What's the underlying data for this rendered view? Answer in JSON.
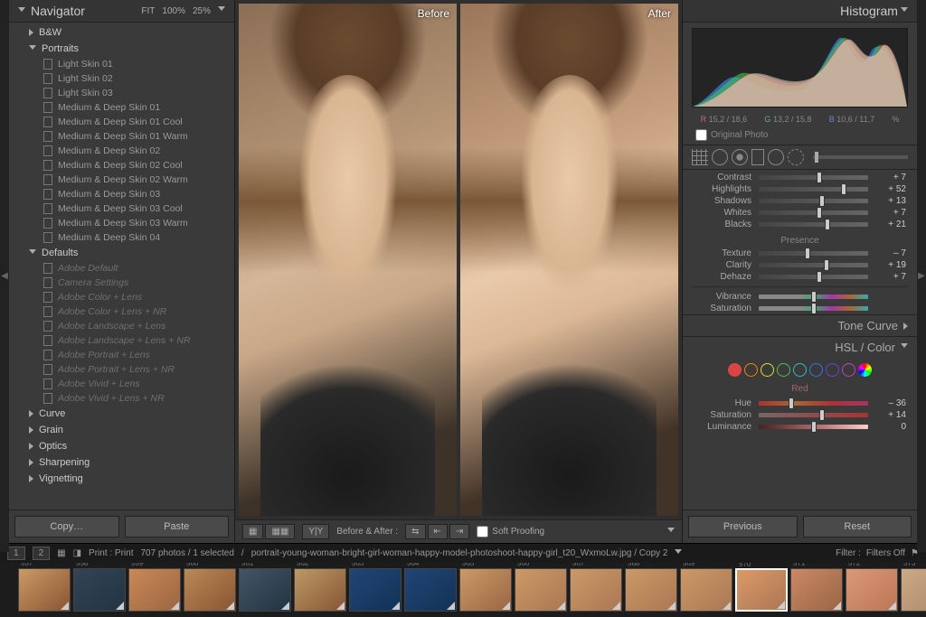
{
  "navigator": {
    "title": "Navigator",
    "zoom": [
      "FIT",
      "100%",
      "25%"
    ]
  },
  "presets": {
    "groups": [
      {
        "name": "B&W",
        "open": false,
        "items": []
      },
      {
        "name": "Portraits",
        "open": true,
        "items": [
          "Light Skin 01",
          "Light Skin 02",
          "Light Skin 03",
          "Medium & Deep Skin 01",
          "Medium & Deep Skin 01 Cool",
          "Medium & Deep Skin 01 Warm",
          "Medium & Deep Skin 02",
          "Medium & Deep Skin 02 Cool",
          "Medium & Deep Skin 02 Warm",
          "Medium & Deep Skin 03",
          "Medium & Deep Skin 03 Cool",
          "Medium & Deep Skin 03 Warm",
          "Medium & Deep Skin 04"
        ]
      },
      {
        "name": "Defaults",
        "open": true,
        "items": [
          "Adobe Default",
          "Camera Settings",
          "Adobe Color + Lens",
          "Adobe Color + Lens + NR",
          "Adobe Landscape + Lens",
          "Adobe Landscape + Lens + NR",
          "Adobe Portrait + Lens",
          "Adobe Portrait + Lens + NR",
          "Adobe Vivid + Lens",
          "Adobe Vivid + Lens + NR"
        ],
        "dim": true
      },
      {
        "name": "Curve",
        "open": false,
        "items": []
      },
      {
        "name": "Grain",
        "open": false,
        "items": []
      },
      {
        "name": "Optics",
        "open": false,
        "items": []
      },
      {
        "name": "Sharpening",
        "open": false,
        "items": []
      },
      {
        "name": "Vignetting",
        "open": false,
        "items": []
      }
    ]
  },
  "leftButtons": {
    "copy": "Copy…",
    "paste": "Paste"
  },
  "compare": {
    "before": "Before",
    "after": "After",
    "toolbar_label": "Before & After :",
    "soft_proof": "Soft Proofing"
  },
  "rightButtons": {
    "prev": "Previous",
    "reset": "Reset"
  },
  "histogram": {
    "title": "Histogram",
    "readout": {
      "rLabel": "R",
      "r": "15,2 / 18,6",
      "gLabel": "G",
      "g": "13,2 / 15,8",
      "bLabel": "B",
      "b": "10,6 / 11,7",
      "pct": "%"
    },
    "original": "Original Photo"
  },
  "basic": {
    "rows": [
      {
        "label": "Contrast",
        "val": "+ 7",
        "pos": 55
      },
      {
        "label": "Highlights",
        "val": "+ 52",
        "pos": 78
      },
      {
        "label": "Shadows",
        "val": "+ 13",
        "pos": 58
      },
      {
        "label": "Whites",
        "val": "+ 7",
        "pos": 55
      },
      {
        "label": "Blacks",
        "val": "+ 21",
        "pos": 63
      }
    ],
    "presence": "Presence",
    "presRows": [
      {
        "label": "Texture",
        "val": "– 7",
        "pos": 45
      },
      {
        "label": "Clarity",
        "val": "+ 19",
        "pos": 62
      },
      {
        "label": "Dehaze",
        "val": "+ 7",
        "pos": 55
      }
    ],
    "colorRows": [
      {
        "label": "Vibrance",
        "val": "",
        "pos": 50,
        "cls": "vib-t"
      },
      {
        "label": "Saturation",
        "val": "",
        "pos": 50,
        "cls": "vib-t"
      }
    ]
  },
  "panels": {
    "tone": "Tone Curve",
    "hsl": "HSL / Color"
  },
  "hsl": {
    "colors": [
      "#d44",
      "#e80",
      "#dd3",
      "#5b5",
      "#3bb",
      "#37d",
      "#64d",
      "#b4b"
    ],
    "channel": "Red",
    "rows": [
      {
        "label": "Hue",
        "val": "– 36",
        "pos": 30,
        "cls": "hue-t"
      },
      {
        "label": "Saturation",
        "val": "+ 14",
        "pos": 58,
        "cls": "sat-t"
      },
      {
        "label": "Luminance",
        "val": "0",
        "pos": 50,
        "cls": "lum-t"
      }
    ]
  },
  "status": {
    "pages": [
      "1",
      "2"
    ],
    "print": "Print : Print",
    "count": "707 photos / 1 selected",
    "crumb": "portrait-young-woman-bright-girl-woman-happy-model-photoshoot-happy-girl_t20_WxmoLw.jpg / Copy 2",
    "filter_label": "Filter :",
    "filter_val": "Filters Off"
  },
  "filmstrip": {
    "start": 557,
    "thumbs": [
      {
        "bg": "linear-gradient(140deg,#c96,#853)"
      },
      {
        "bg": "linear-gradient(140deg,#345,#234)"
      },
      {
        "bg": "linear-gradient(140deg,#c85,#964)"
      },
      {
        "bg": "linear-gradient(140deg,#b85,#853)"
      },
      {
        "bg": "linear-gradient(140deg,#456,#234)"
      },
      {
        "bg": "linear-gradient(140deg,#b96,#853)"
      },
      {
        "bg": "linear-gradient(140deg,#247,#135)"
      },
      {
        "bg": "linear-gradient(140deg,#247,#135)"
      },
      {
        "bg": "linear-gradient(140deg,#c96,#964)"
      },
      {
        "bg": "linear-gradient(140deg,#c96,#a75)"
      },
      {
        "bg": "linear-gradient(140deg,#c96,#a75)"
      },
      {
        "bg": "linear-gradient(140deg,#c96,#a75)"
      },
      {
        "bg": "linear-gradient(140deg,#c96,#a75)"
      },
      {
        "bg": "linear-gradient(140deg,#d96,#a75)",
        "sel": true
      },
      {
        "bg": "linear-gradient(140deg,#c86,#964)"
      },
      {
        "bg": "linear-gradient(140deg,#d97,#b75)"
      },
      {
        "bg": "linear-gradient(140deg,#ca8,#a86)"
      }
    ]
  }
}
